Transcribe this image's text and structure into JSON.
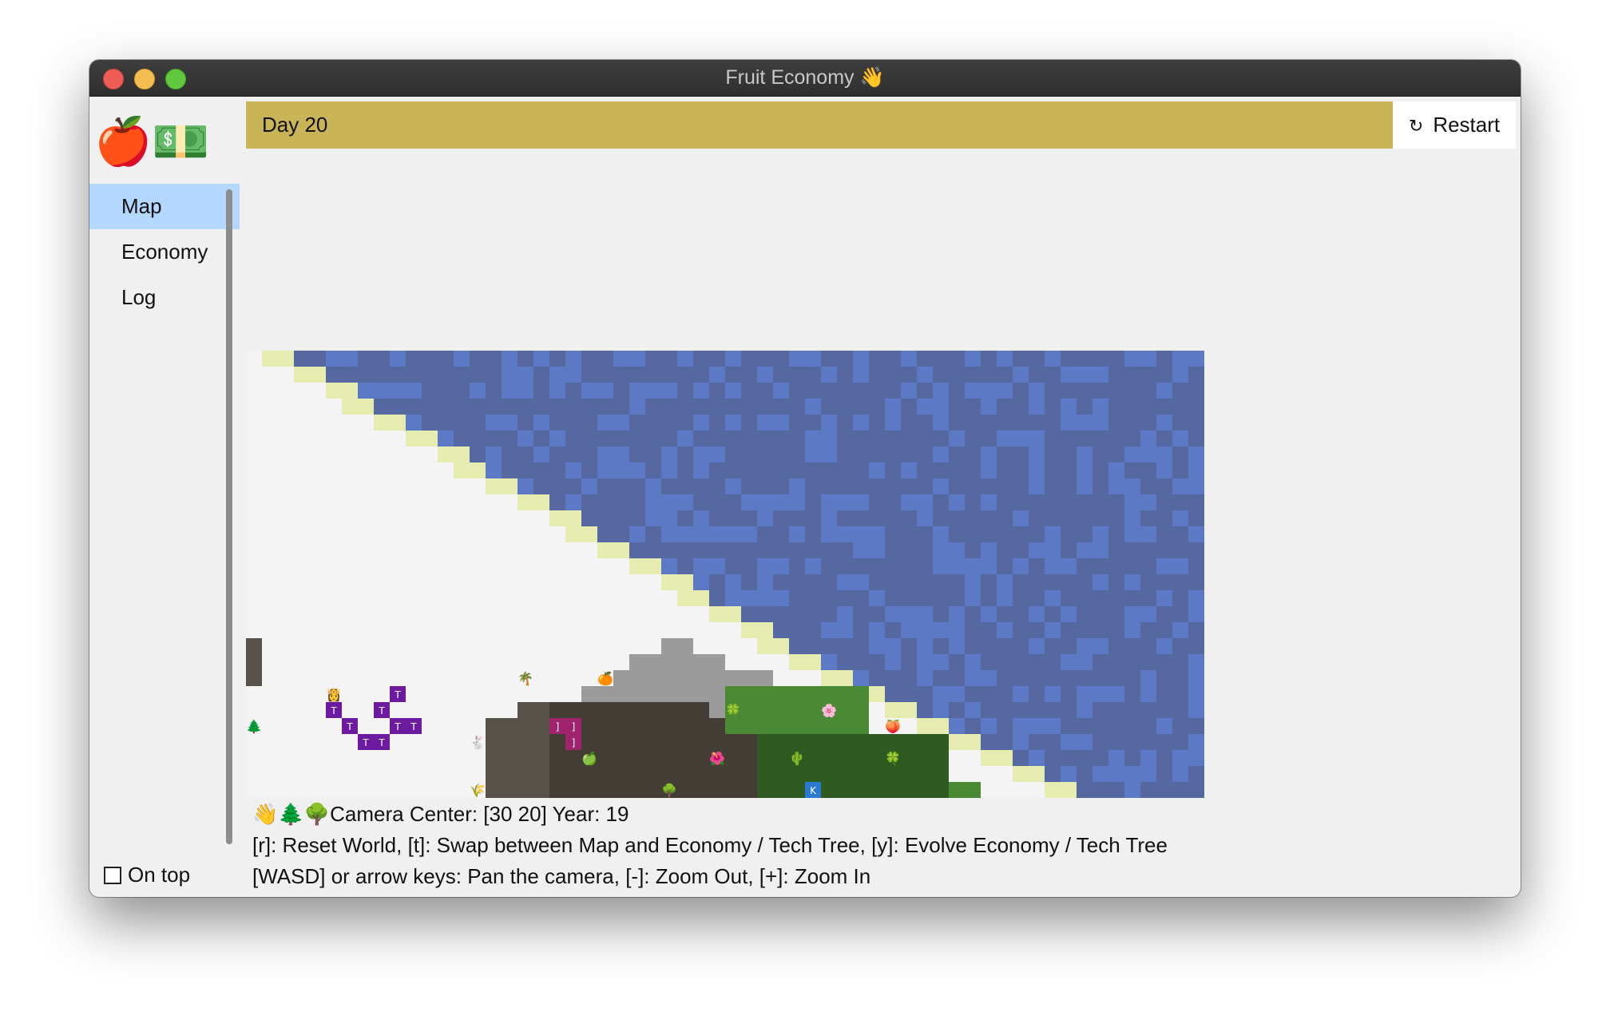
{
  "window": {
    "title": "Fruit Economy 👋"
  },
  "sidebar": {
    "logo": "🍎💵",
    "items": [
      {
        "label": "Map",
        "active": true
      },
      {
        "label": "Economy",
        "active": false
      },
      {
        "label": "Log",
        "active": false
      }
    ],
    "on_top_label": "On top",
    "on_top_checked": false
  },
  "header": {
    "day_label": "Day 20",
    "restart_icon": "↻",
    "restart_label": "Restart",
    "accent_color": "#c9b458"
  },
  "map": {
    "colors": {
      "deep_water": "#5568a0",
      "water": "#5b79c4",
      "beach": "#e6ecb0",
      "snow": "#f4f4f4",
      "rock": "#9b9b9b",
      "dirt": "#443d35",
      "dirt_light": "#57514a",
      "grass": "#4a8a35",
      "forest": "#2f5a22",
      "territory": "#6c1aa0",
      "market": "#a0236d",
      "city": "#2a7ad4"
    },
    "units": [
      {
        "glyph": "🌴",
        "name": "palm-tree-icon"
      },
      {
        "glyph": "🍊",
        "name": "orange-icon"
      },
      {
        "glyph": "🍀",
        "name": "clover-icon"
      },
      {
        "glyph": "🌸",
        "name": "blossom-icon"
      },
      {
        "glyph": "🍏",
        "name": "apple-icon"
      },
      {
        "glyph": "🌺",
        "name": "hibiscus-icon"
      },
      {
        "glyph": "🌵",
        "name": "cactus-icon"
      },
      {
        "glyph": "🍀",
        "name": "clover-icon"
      },
      {
        "glyph": "🌳",
        "name": "tree-icon"
      },
      {
        "glyph": "🌲",
        "name": "evergreen-icon"
      },
      {
        "glyph": "👸",
        "name": "ruler-icon"
      },
      {
        "glyph": "🐇",
        "name": "rabbit-icon"
      },
      {
        "glyph": "🌾",
        "name": "grain-icon"
      },
      {
        "glyph": "🍑",
        "name": "peach-icon"
      }
    ],
    "territory_letter": "T",
    "market_letter": "]",
    "city_letter": "K"
  },
  "status": {
    "line1": "👋🌲🌳Camera Center: [30 20] Year: 19",
    "line2": "[r]: Reset World, [t]: Swap between Map and Economy / Tech Tree, [y]: Evolve Economy / Tech Tree",
    "line3": "[WASD] or arrow keys: Pan the camera, [-]: Zoom Out, [+]: Zoom In"
  }
}
